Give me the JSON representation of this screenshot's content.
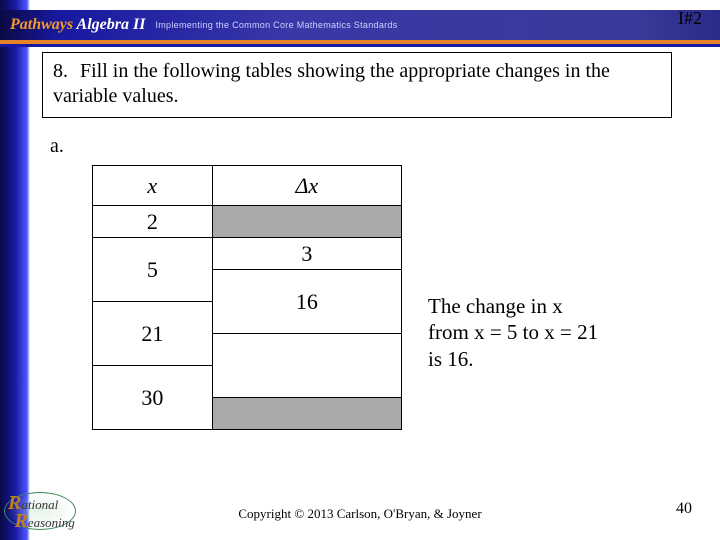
{
  "header": {
    "brand": "Pathways",
    "product": "Algebra II",
    "subtitle": "Implementing the Common Core Mathematics Standards"
  },
  "slide_id": "I#2",
  "question": {
    "number": "8.",
    "text": "Fill in the following tables showing the appropriate changes in the variable values."
  },
  "part": "a.",
  "table": {
    "col1_header": "x",
    "col2_header": "Δx",
    "x_values": [
      "2",
      "5",
      "21",
      "30"
    ],
    "dx_values": [
      "3",
      "16"
    ]
  },
  "explanation": {
    "line1": "The change in x",
    "line2": "from x = 5 to x = 21",
    "line3": "is 16."
  },
  "footer": {
    "copyright": "Copyright © 2013 Carlson, O'Bryan, & Joyner",
    "page": "40"
  },
  "logo": {
    "word1_initial": "R",
    "word1_rest": "ational",
    "word2_initial": "R",
    "word2_rest": "easoning"
  }
}
